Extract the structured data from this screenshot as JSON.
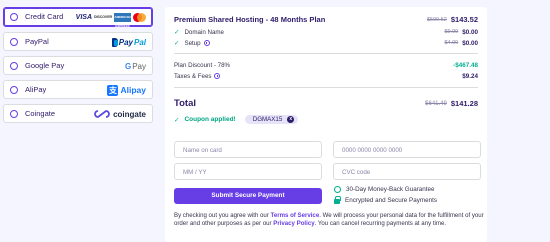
{
  "payment_methods": [
    {
      "label": "Credit Card",
      "selected": true,
      "logos": [
        "visa-logo",
        "discover-logo",
        "amex-logo",
        "mastercard-logo"
      ],
      "visa_text": "VISA",
      "discover_text": "DISCOVER",
      "amex_text": "AMERICAN EXPRESS"
    },
    {
      "label": "PayPal",
      "selected": false,
      "logo_text_1": "Pay",
      "logo_text_2": "Pal"
    },
    {
      "label": "Google Pay",
      "selected": false,
      "logo_text_g": "G",
      "logo_text": "Pay"
    },
    {
      "label": "AliPay",
      "selected": false,
      "logo_mark": "支",
      "logo_text": "Alipay"
    },
    {
      "label": "Coingate",
      "selected": false,
      "logo_text": "coingate"
    }
  ],
  "summary": {
    "plan": {
      "title": "Premium Shared Hosting - 48 Months Plan",
      "old_price": "$599.52",
      "price": "$143.52"
    },
    "features": [
      {
        "label": "Domain Name",
        "old_price": "$9.99",
        "price": "$0.00"
      },
      {
        "label": "Setup",
        "old_price": "$4.99",
        "price": "$0.00"
      }
    ],
    "discount": {
      "label": "Plan Discount - 78%",
      "value": "-$467.48"
    },
    "taxes": {
      "label": "Taxes & Fees",
      "value": "$9.24"
    },
    "total": {
      "label": "Total",
      "old_price": "$641.49",
      "price": "$141.28"
    },
    "coupon": {
      "text": "Coupon applied!",
      "code": "DGMAX15",
      "remove_icon": "x"
    }
  },
  "form": {
    "name_placeholder": "Name on card",
    "card_placeholder": "0000 0000 0000 0000",
    "expiry_placeholder": "MM / YY",
    "cvc_placeholder": "CVC code",
    "submit_label": "Submit Secure Payment",
    "guarantee_label": "30-Day Money-Back Guarantee",
    "secure_label": "Encrypted and Secure Payments"
  },
  "legal": {
    "part1": "By checking out you agree with our ",
    "terms_link": "Terms of Service",
    "part2": ". We will process your personal data for the fulfillment of your order and other purposes as per our ",
    "privacy_link": "Privacy Policy",
    "part3": ". You can cancel recurring payments at any time."
  },
  "colors": {
    "accent": "#673de6",
    "success": "#00b090",
    "text": "#2f1c6a",
    "background": "#f4f5ff"
  }
}
